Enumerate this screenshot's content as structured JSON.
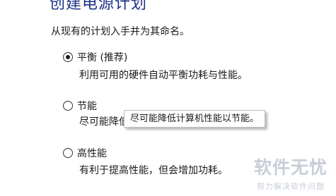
{
  "page": {
    "title": "创建电源计划",
    "subtitle": "从现有的计划入手并为其命名。"
  },
  "plans": [
    {
      "label": "平衡 (推荐)",
      "description": "利用可用的硬件自动平衡功耗与性能。",
      "selected": true
    },
    {
      "label": "节能",
      "description": "尽可能降低计算机性能以节能。",
      "selected": false
    },
    {
      "label": "高性能",
      "description": "有利于提高性能，但会增加功耗。",
      "selected": false
    }
  ],
  "tooltip": {
    "text": "尽可能降低计算机性能以节能。"
  },
  "watermark": {
    "main": "软件无忧",
    "sub": "努力解决软件问题"
  },
  "colors": {
    "title": "#1e3287",
    "text": "#1a1a1a",
    "watermark": "#c5ccd6"
  }
}
